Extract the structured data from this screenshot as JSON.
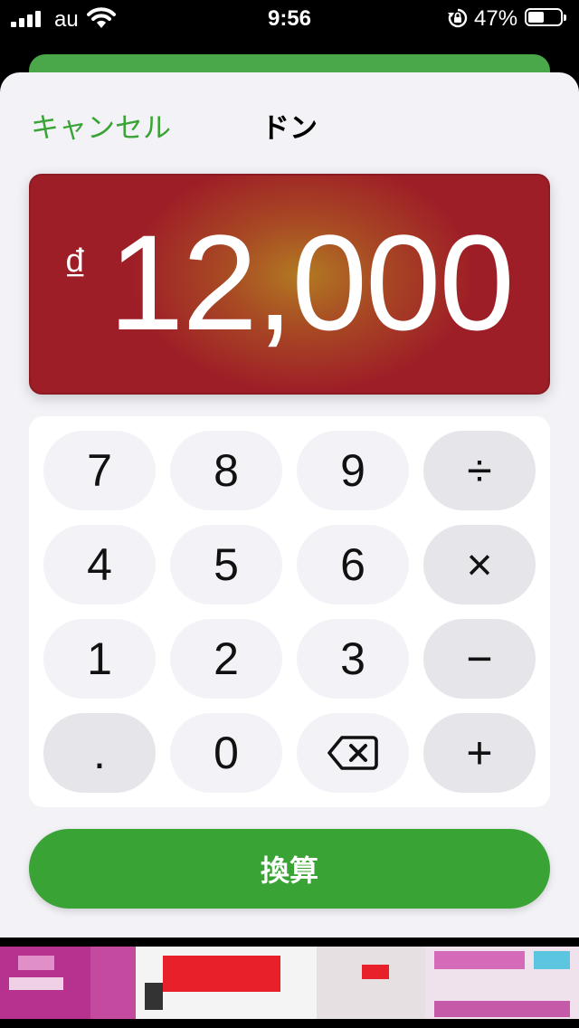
{
  "status_bar": {
    "carrier": "au",
    "time": "9:56",
    "battery_percent": "47%",
    "battery_level": 0.47
  },
  "header": {
    "cancel_label": "キャンセル",
    "title": "ドン"
  },
  "display": {
    "currency_symbol": "₫",
    "amount": "12,000"
  },
  "keypad": {
    "rows": [
      [
        "7",
        "8",
        "9",
        "÷"
      ],
      [
        "4",
        "5",
        "6",
        "×"
      ],
      [
        "1",
        "2",
        "3",
        "−"
      ],
      [
        ".",
        "0",
        "backspace",
        "+"
      ]
    ]
  },
  "convert_button_label": "換算",
  "colors": {
    "accent_green": "#3aa335",
    "display_red": "#9e1e27",
    "sheet_bg": "#f2f2f7"
  },
  "icons": {
    "backspace": "delete-left-icon"
  }
}
